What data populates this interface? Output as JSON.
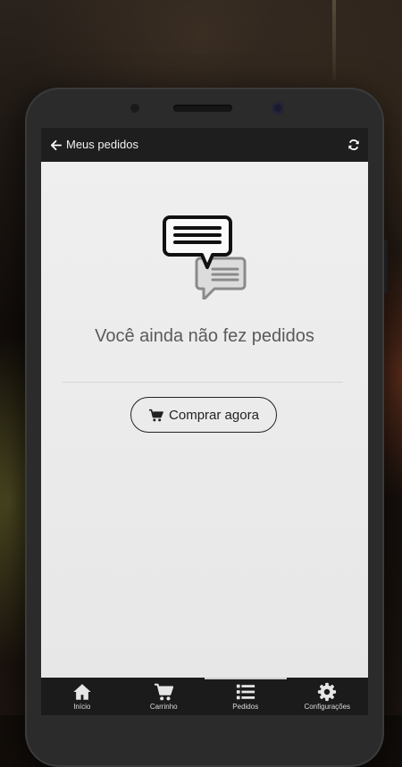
{
  "appbar": {
    "title": "Meus pedidos",
    "back_icon": "arrow-left-icon",
    "refresh_icon": "refresh-icon"
  },
  "empty_state": {
    "icon": "chat-bubbles-icon",
    "message": "Você ainda não fez pedidos",
    "cta_icon": "cart-icon",
    "cta_label": "Comprar agora"
  },
  "tabbar": {
    "active": "Pedidos",
    "items": [
      {
        "label": "Início",
        "icon": "home-icon"
      },
      {
        "label": "Carrinho",
        "icon": "cart-icon"
      },
      {
        "label": "Pedidos",
        "icon": "list-icon"
      },
      {
        "label": "Configurações",
        "icon": "gear-icon"
      }
    ]
  },
  "colors": {
    "appbar_bg": "#1e1e1e",
    "screen_bg": "#ededed",
    "tabbar_bg": "#1b1b1b",
    "text_muted": "#5a5a5a"
  }
}
